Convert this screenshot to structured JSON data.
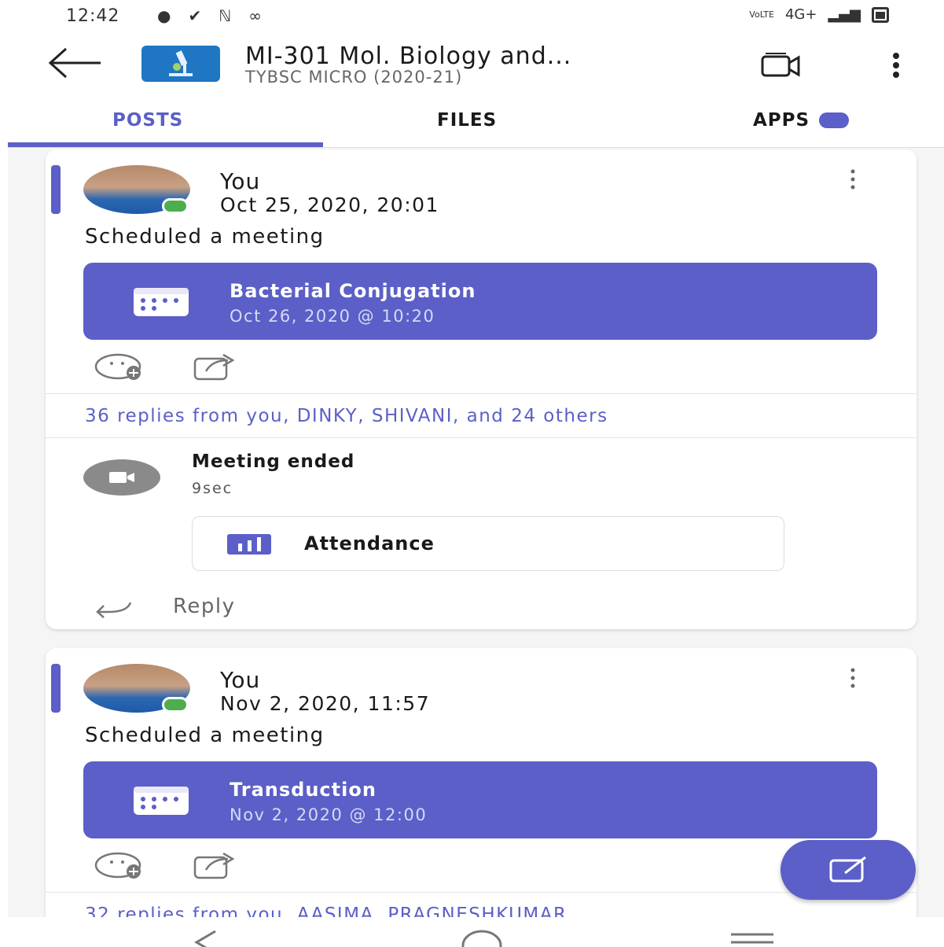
{
  "status_bar": {
    "time": "12:42",
    "network": "4G+",
    "volte": "VoLTE"
  },
  "header": {
    "title": "MI-301 Mol. Biology and...",
    "subtitle": "TYBSC MICRO (2020-21)"
  },
  "tabs": [
    {
      "label": "POSTS",
      "selected": true
    },
    {
      "label": "FILES",
      "selected": false
    },
    {
      "label": "APPS",
      "selected": false
    }
  ],
  "colors": {
    "accent": "#5b5fc7",
    "presence": "#4cae4c"
  },
  "posts": [
    {
      "author": "You",
      "timestamp": "Oct 25, 2020, 20:01",
      "text": "Scheduled a meeting",
      "meeting": {
        "title": "Bacterial Conjugation",
        "time": "Oct 26, 2020 @ 10:20"
      },
      "replies": "36 replies from you, DINKY, SHIVANI, and 24 others",
      "meeting_ended": {
        "title": "Meeting ended",
        "duration": "9sec",
        "attendance_label": "Attendance"
      },
      "reply_label": "Reply"
    },
    {
      "author": "You",
      "timestamp": "Nov 2, 2020, 11:57",
      "text": "Scheduled a meeting",
      "meeting": {
        "title": "Transduction",
        "time": "Nov 2, 2020 @ 12:00"
      },
      "replies": "32 replies from you, AASIMA, PRAGNESHKUMAR"
    }
  ],
  "icons": {
    "back": "arrow-left-icon",
    "video": "video-call-icon",
    "more": "more-vertical-icon",
    "calendar": "calendar-icon",
    "react": "add-reaction-icon",
    "share": "share-icon",
    "attendance": "bar-chart-icon",
    "reply": "reply-icon",
    "compose": "compose-icon"
  }
}
